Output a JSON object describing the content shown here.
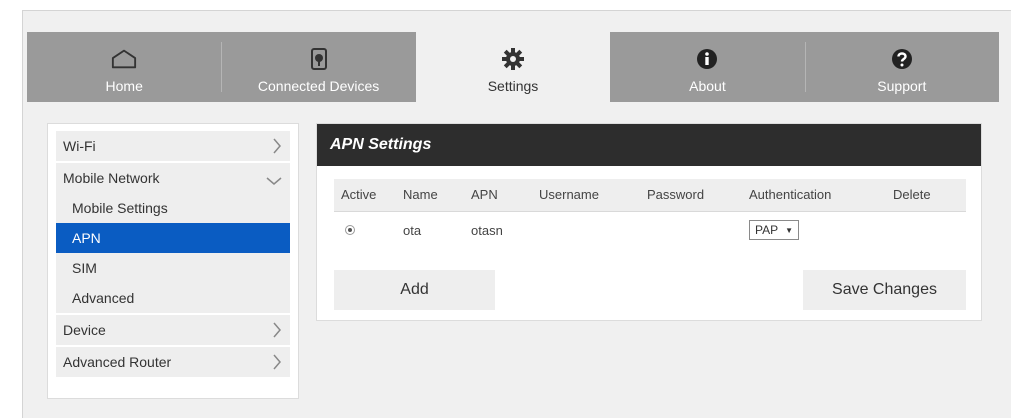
{
  "nav": {
    "tabs": [
      {
        "label": "Home",
        "icon": "home-icon"
      },
      {
        "label": "Connected Devices",
        "icon": "connected-devices-icon"
      },
      {
        "label": "Settings",
        "icon": "gear-icon",
        "active": true
      },
      {
        "label": "About",
        "icon": "info-icon"
      },
      {
        "label": "Support",
        "icon": "help-icon"
      }
    ]
  },
  "sidebar": {
    "wifi": "Wi-Fi",
    "mobile_network": "Mobile Network",
    "mobile_settings": "Mobile Settings",
    "apn": "APN",
    "sim": "SIM",
    "advanced": "Advanced",
    "device": "Device",
    "advanced_router": "Advanced Router"
  },
  "panel": {
    "title": "APN Settings",
    "columns": [
      "Active",
      "Name",
      "APN",
      "Username",
      "Password",
      "Authentication",
      "Delete"
    ],
    "rows": [
      {
        "active": true,
        "name": "ota",
        "apn": "otasn",
        "username": "",
        "password": "",
        "authentication": "PAP"
      }
    ],
    "add_label": "Add",
    "save_label": "Save Changes"
  },
  "colors": {
    "accent": "#0a5cc2",
    "nav_bg": "#9a9a9a",
    "header_bg": "#2d2d2d"
  }
}
